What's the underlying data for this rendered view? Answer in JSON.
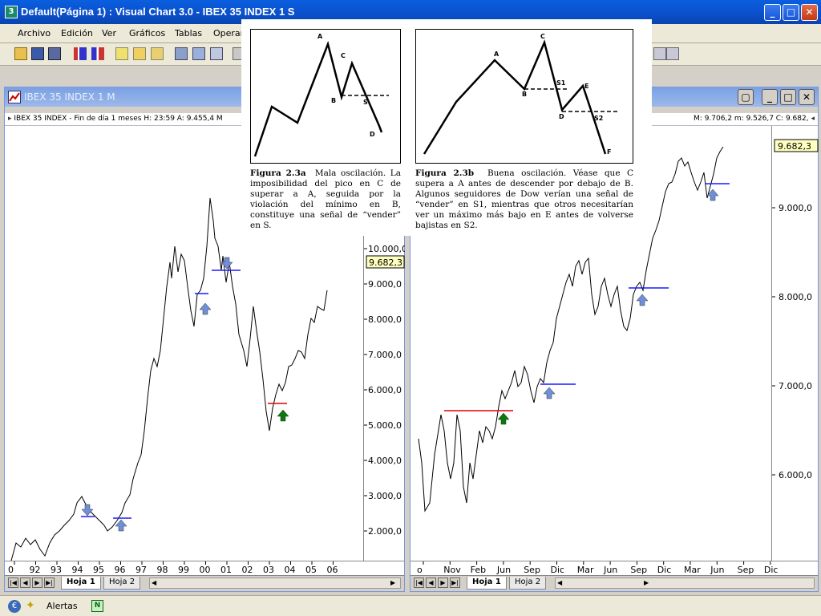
{
  "window": {
    "title": "Default(Página 1) : Visual Chart  3.0 - IBEX 35 INDEX 1 S",
    "icon_text": "3",
    "min": "_",
    "max": "□",
    "close": "✕"
  },
  "menu": [
    "Archivo",
    "Edición",
    "Ver",
    "Gráficos",
    "Tablas",
    "Operar"
  ],
  "left_window": {
    "title": "IBEX 35 INDEX 1 M",
    "info": "IBEX 35 INDEX - Fin de día 1 meses  H: 23:59  A: 9.455,4  M",
    "price_tag": "9.682,3",
    "yticks": [
      "10.000,0",
      "9.000,0",
      "8.000,0",
      "7.000,0",
      "6.000,0",
      "5.000,0",
      "4.000,0",
      "3.000,0",
      "2.000,0"
    ],
    "xticks": [
      "0",
      "92",
      "93",
      "94",
      "95",
      "96",
      "97",
      "98",
      "99",
      "00",
      "01",
      "02",
      "03",
      "04",
      "05",
      "06"
    ],
    "tabs": [
      "Hoja 1",
      "Hoja 2"
    ]
  },
  "right_window": {
    "info": "M: 9.706,2  m: 9.526,7  C: 9.682,",
    "price_tag": "9.682,3",
    "yticks": [
      "9.000,0",
      "8.000,0",
      "7.000,0",
      "6.000,0"
    ],
    "xticks": [
      "o",
      "Nov",
      "Feb",
      "Jun",
      "Sep",
      "Dic",
      "Mar",
      "Jun",
      "Sep",
      "Dic",
      "Mar",
      "Jun",
      "Sep",
      "Dic"
    ],
    "tabs": [
      "Hoja 1",
      "Hoja 2"
    ]
  },
  "figure_a": {
    "points": [
      "A",
      "B",
      "C",
      "S",
      "D"
    ],
    "caption_label": "Figura 2.3a",
    "caption": "Mala oscilación. La imposibilidad del pico en C de superar a A, seguida por la violación del mínimo en B, constituye una señal de “vender” en S."
  },
  "figure_b": {
    "points": [
      "A",
      "B",
      "C",
      "S1",
      "D",
      "E",
      "S2",
      "F"
    ],
    "caption_label": "Figura 2.3b",
    "caption": "Buena oscilación. Véase que C supera a A antes de descender por debajo de B. Algunos seguidores de Dow verían una señal de “vender” en S1, mientras que otros necesitarían ver un máximo más bajo en E antes de volverse bajistas en S2."
  },
  "status": {
    "alerts": "Alertas"
  },
  "colors": {
    "title_blue": "#0b4fc9",
    "signal_blue": "#1a1aff",
    "signal_red": "#e00000",
    "arrow_green": "#0a7a0a",
    "arrow_blue": "#6f8fd8"
  }
}
